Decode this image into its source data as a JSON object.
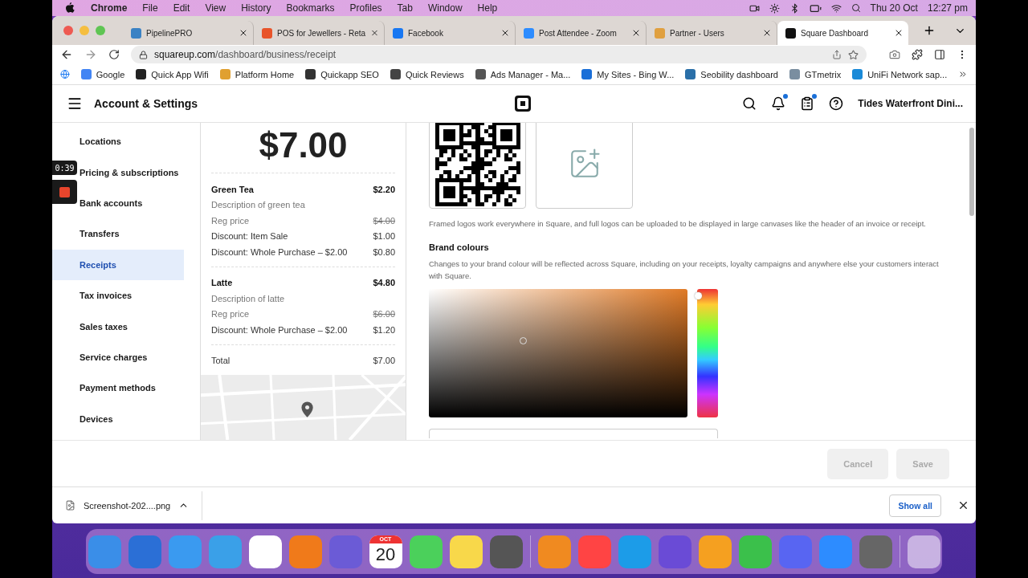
{
  "menu_bar": {
    "app": "Chrome",
    "items": [
      "File",
      "Edit",
      "View",
      "History",
      "Bookmarks",
      "Profiles",
      "Tab",
      "Window",
      "Help"
    ],
    "date": "Thu 20 Oct",
    "time": "12:27 pm"
  },
  "tabs": [
    {
      "title": "PipelinePRO",
      "selected": false,
      "color": "#3b82c4"
    },
    {
      "title": "POS for Jewellers - Reta",
      "selected": false,
      "color": "#e8542a"
    },
    {
      "title": "Facebook",
      "selected": false,
      "color": "#1877f2"
    },
    {
      "title": "Post Attendee - Zoom",
      "selected": false,
      "color": "#2d8cff"
    },
    {
      "title": "Partner - Users",
      "selected": false,
      "color": "#e0a040"
    },
    {
      "title": "Square Dashboard",
      "selected": true,
      "color": "#111111"
    }
  ],
  "address": {
    "host": "squareup.com",
    "path": "/dashboard/business/receipt"
  },
  "bookmarks": [
    {
      "label": "Google",
      "color": "#4285f4"
    },
    {
      "label": "Quick App Wifi",
      "color": "#222222"
    },
    {
      "label": "Platform Home",
      "color": "#e0a030"
    },
    {
      "label": "Quickapp SEO",
      "color": "#333333"
    },
    {
      "label": "Quick Reviews",
      "color": "#444444"
    },
    {
      "label": "Ads Manager - Ma...",
      "color": "#555555"
    },
    {
      "label": "My Sites - Bing W...",
      "color": "#1a6fd8"
    },
    {
      "label": "Seobility dashboard",
      "color": "#2a6fa8"
    },
    {
      "label": "GTmetrix",
      "color": "#7a8ea0"
    },
    {
      "label": "UniFi Network sap...",
      "color": "#1a8ad8"
    }
  ],
  "header": {
    "title": "Account & Settings",
    "business": "Tides Waterfront Dini..."
  },
  "recording": {
    "timer": "0:39"
  },
  "sidebar": {
    "items": [
      {
        "label": "Locations",
        "selected": false
      },
      {
        "label": "Pricing & subscriptions",
        "selected": false
      },
      {
        "label": "Bank accounts",
        "selected": false
      },
      {
        "label": "Transfers",
        "selected": false
      },
      {
        "label": "Receipts",
        "selected": true
      },
      {
        "label": "Tax invoices",
        "selected": false
      },
      {
        "label": "Sales taxes",
        "selected": false
      },
      {
        "label": "Service charges",
        "selected": false
      },
      {
        "label": "Payment methods",
        "selected": false
      },
      {
        "label": "Devices",
        "selected": false
      }
    ]
  },
  "receipt": {
    "amount": "$7.00",
    "items": [
      {
        "name": "Green Tea",
        "price": "$2.20",
        "description": "Description of green tea",
        "lines": [
          {
            "kind": "regular",
            "label": "Reg price",
            "amount": "$4.00"
          },
          {
            "kind": "discount",
            "label": "Discount: Item Sale",
            "amount": "$1.00"
          },
          {
            "kind": "discount",
            "label": "Discount: Whole Purchase – $2.00",
            "amount": "$0.80"
          }
        ]
      },
      {
        "name": "Latte",
        "price": "$4.80",
        "description": "Description of latte",
        "lines": [
          {
            "kind": "regular",
            "label": "Reg price",
            "amount": "$6.00"
          },
          {
            "kind": "discount",
            "label": "Discount: Whole Purchase – $2.00",
            "amount": "$1.20"
          }
        ]
      }
    ],
    "total_label": "Total",
    "total": "$7.00"
  },
  "logos": {
    "caption": "Framed logos work everywhere in Square, and full logos can be uploaded to be displayed in large canvases like the header of an invoice or receipt."
  },
  "brand": {
    "title": "Brand colours",
    "description": "Changes to your brand colour will be reflected across Square, including on your receipts, loyalty campaigns and anywhere else your customers interact with Square.",
    "hue": {
      "level": 0.05
    }
  },
  "footer": {
    "buttons": [
      {
        "label": "Cancel",
        "disabled": true
      },
      {
        "label": "Save",
        "disabled": true
      }
    ]
  },
  "downloads": {
    "file": "Screenshot-202....png",
    "show_all": "Show all"
  },
  "dock": {
    "calendar_month": "OCT",
    "calendar_day": "20"
  }
}
